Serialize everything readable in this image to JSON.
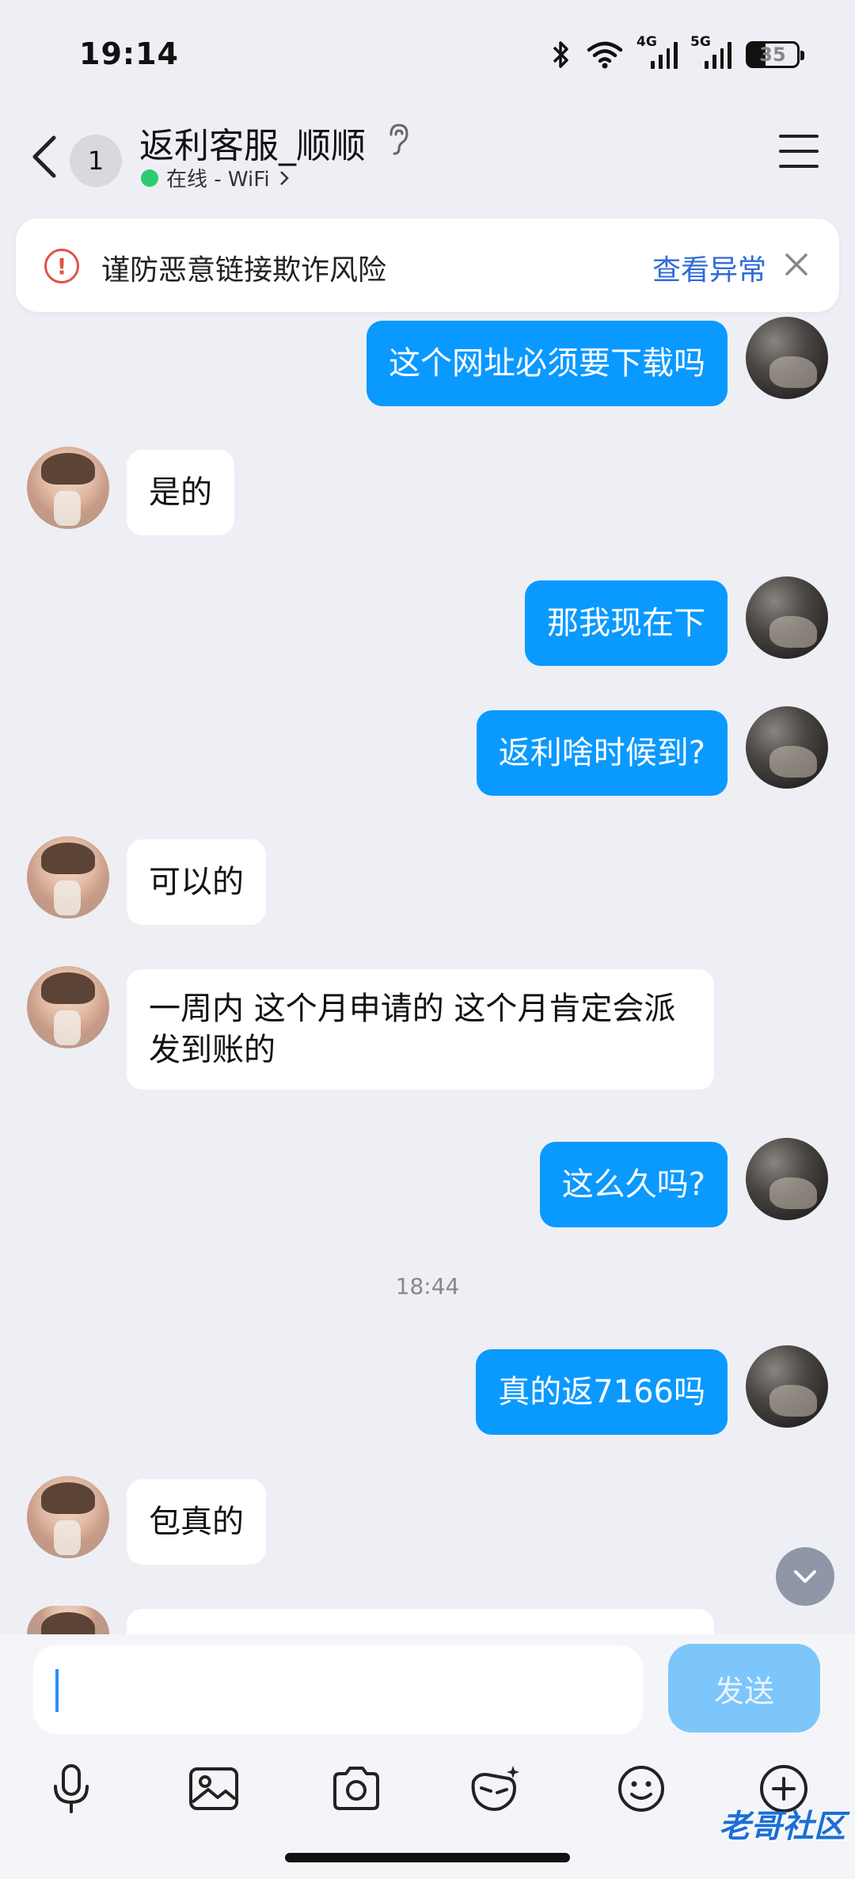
{
  "status_bar": {
    "time": "19:14",
    "battery": "35",
    "sig1": "4G",
    "sig2": "5G"
  },
  "header": {
    "unread": "1",
    "title": "返利客服_顺顺",
    "presence": "在线 - WiFi"
  },
  "warning": {
    "text": "谨防恶意链接欺诈风险",
    "link": "查看异常"
  },
  "messages": [
    {
      "side": "out",
      "text": "这个网址必须要下载吗"
    },
    {
      "side": "in",
      "text": "是的"
    },
    {
      "side": "out",
      "text": "那我现在下"
    },
    {
      "side": "out",
      "text": "返利啥时候到?"
    },
    {
      "side": "in",
      "text": "可以的"
    },
    {
      "side": "in",
      "text": "一周内 这个月申请的 这个月肯定会派发到账的"
    },
    {
      "side": "out",
      "text": "这么久吗?"
    },
    {
      "side": "out",
      "text": "真的返7166吗"
    },
    {
      "side": "in",
      "text": "包真的"
    }
  ],
  "timestamp": "18:44",
  "composer": {
    "placeholder": "",
    "send_label": "发送"
  },
  "toolbar": [
    "mic-icon",
    "image-icon",
    "camera-icon",
    "voice-effect-icon",
    "emoji-icon",
    "plus-icon"
  ],
  "watermark": "老哥社区"
}
